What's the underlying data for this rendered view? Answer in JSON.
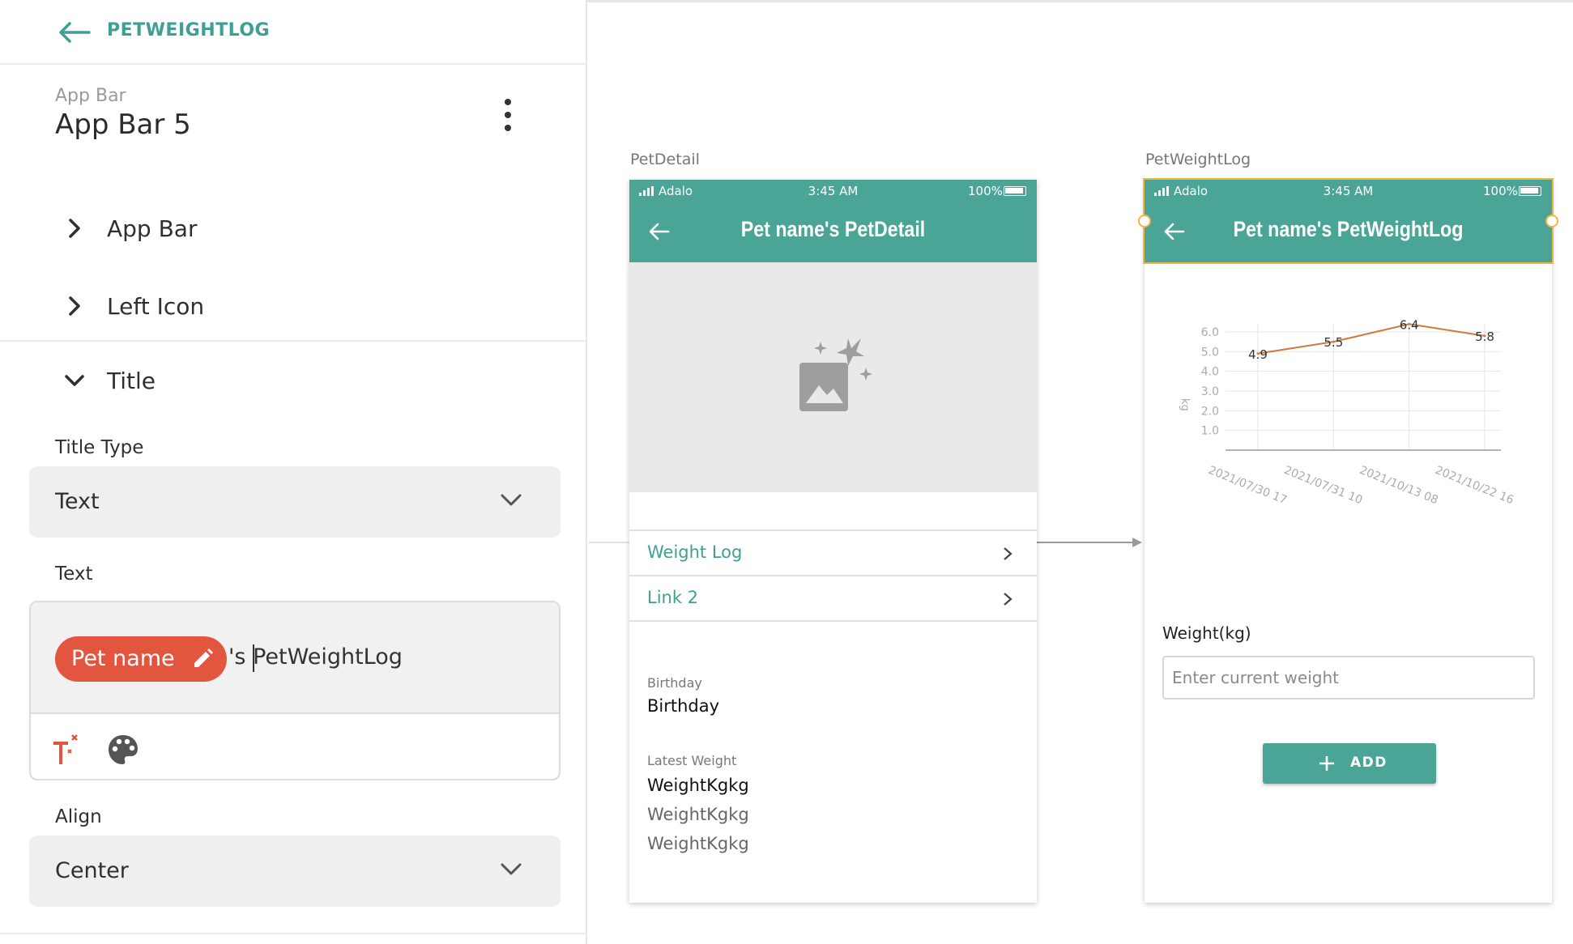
{
  "panel": {
    "app_name": "PETWEIGHTLOG",
    "component_type": "App Bar",
    "component_name": "App Bar 5",
    "sections": [
      {
        "label": "App Bar",
        "expanded": false
      },
      {
        "label": "Left Icon",
        "expanded": false
      },
      {
        "label": "Title",
        "expanded": true
      }
    ],
    "title_type_label": "Title Type",
    "title_type_value": "Text",
    "text_label": "Text",
    "text_chip": "Pet name",
    "text_after_chip": "'s PetWeightLog",
    "align_label": "Align",
    "align_value": "Center"
  },
  "canvas": {
    "screens": [
      {
        "label": "PetDetail",
        "status": {
          "carrier": "Adalo",
          "time": "3:45 AM",
          "battery": "100%"
        },
        "title": "Pet name's PetDetail",
        "links": [
          "Weight Log",
          "Link 2"
        ],
        "birthday_label": "Birthday",
        "birthday_value": "Birthday",
        "latest_weight_label": "Latest Weight",
        "weights": [
          "WeightKgkg",
          "WeightKgkg",
          "WeightKgkg"
        ]
      },
      {
        "label": "PetWeightLog",
        "status": {
          "carrier": "Adalo",
          "time": "3:45 AM",
          "battery": "100%"
        },
        "title": "Pet name's PetWeightLog",
        "weight_label": "Weight(kg)",
        "weight_placeholder": "Enter current weight",
        "add_label": "ADD"
      }
    ]
  },
  "colors": {
    "accent": "#4aa597",
    "accent_text": "#3f9f94",
    "chip": "#e2553f",
    "selection": "#f2b544",
    "chart_line": "#d2783c"
  },
  "icons": [
    "back-arrow-icon",
    "more-vert-icon",
    "chevron-right-icon",
    "chevron-down-icon",
    "pencil-icon",
    "magic-text-icon",
    "palette-icon",
    "image-placeholder-icon",
    "plus-icon"
  ],
  "chart_data": {
    "type": "line",
    "ylabel": "kg",
    "ylim": [
      0,
      6.0
    ],
    "yticks": [
      "1.0",
      "2.0",
      "3.0",
      "4.0",
      "5.0",
      "6.0"
    ],
    "categories": [
      "2021/07/30 17",
      "2021/07/31 10",
      "2021/10/13 08",
      "2021/10/22 16"
    ],
    "values": [
      4.9,
      5.5,
      6.4,
      5.8
    ],
    "value_labels": [
      "4.9",
      "5.5",
      "6.4",
      "5.8"
    ],
    "grid": true
  }
}
